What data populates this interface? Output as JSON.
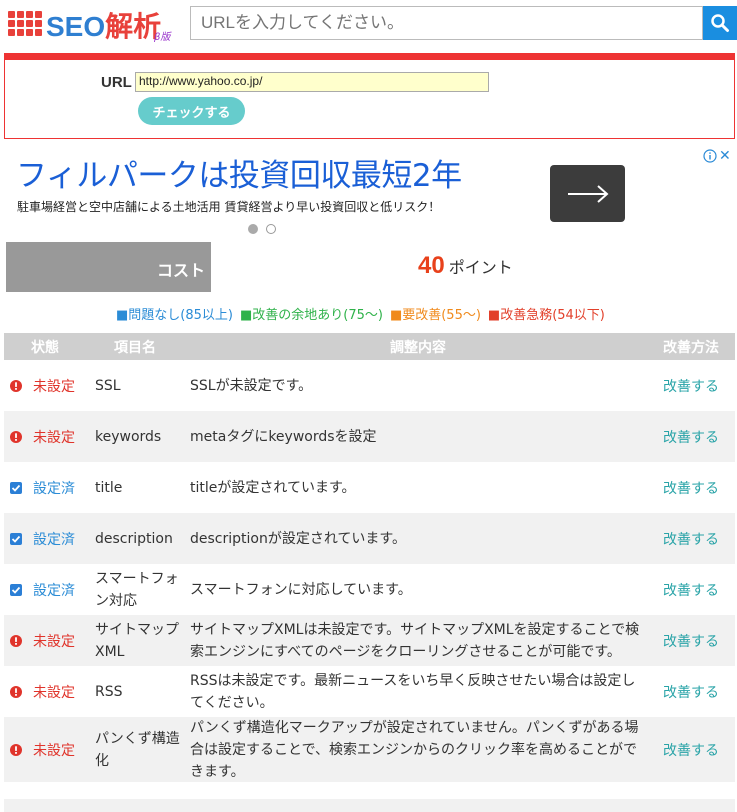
{
  "header": {
    "logo_text": "SEO",
    "logo_kanji": "解析",
    "logo_sub": "β版",
    "search_placeholder": "URLを入力してください。"
  },
  "form": {
    "url_label": "URL",
    "url_value": "http://www.yahoo.co.jp/",
    "check_button": "チェックする"
  },
  "ad": {
    "headline": "フィルパークは投資回収最短2年",
    "description": "駐車場経営と空中店舗による土地活用 賃貸経営より早い投資回収と低リスク！",
    "close_label": "✕"
  },
  "cost": {
    "label": "コスト",
    "points": "40",
    "points_unit": "ポイント"
  },
  "legend": {
    "blue": "■問題なし(85以上)",
    "green": "■改善の余地あり(75〜)",
    "orange": "■要改善(55〜)",
    "red": "■改善急務(54以下)"
  },
  "table": {
    "headers": [
      "状態",
      "項目名",
      "調整内容",
      "改善方法"
    ],
    "rows": [
      {
        "status": "未設定",
        "state": "ng",
        "name": "SSL",
        "desc": "SSLが未設定です。",
        "fix": "改善する"
      },
      {
        "status": "未設定",
        "state": "ng",
        "name": "keywords",
        "desc": "metaタグにkeywordsを設定",
        "fix": "改善する"
      },
      {
        "status": "設定済",
        "state": "ok",
        "name": "title",
        "desc": "titleが設定されています。",
        "fix": "改善する"
      },
      {
        "status": "設定済",
        "state": "ok",
        "name": "description",
        "desc": "descriptionが設定されています。",
        "fix": "改善する"
      },
      {
        "status": "設定済",
        "state": "ok",
        "name": "スマートフォン対応",
        "desc": "スマートフォンに対応しています。",
        "fix": "改善する"
      },
      {
        "status": "未設定",
        "state": "ng",
        "name": "サイトマップXML",
        "desc": "サイトマップXMLは未設定です。サイトマップXMLを設定することで検索エンジンにすべてのページをクローリングさせることが可能です。",
        "fix": "改善する"
      },
      {
        "status": "未設定",
        "state": "ng",
        "name": "RSS",
        "desc": "RSSは未設定です。最新ニュースをいち早く反映させたい場合は設定してください。",
        "fix": "改善する"
      },
      {
        "status": "未設定",
        "state": "ng",
        "name": "パンくず構造化",
        "desc": "パンくず構造化マークアップが設定されていません。パンくずがある場合は設定することで、検索エンジンからのクリック率を高めることができます。",
        "fix": "改善する"
      }
    ]
  },
  "colors": {
    "accent_red": "#e33333",
    "brand_blue": "#2f7fd1",
    "link_teal": "#2aa4a8"
  }
}
